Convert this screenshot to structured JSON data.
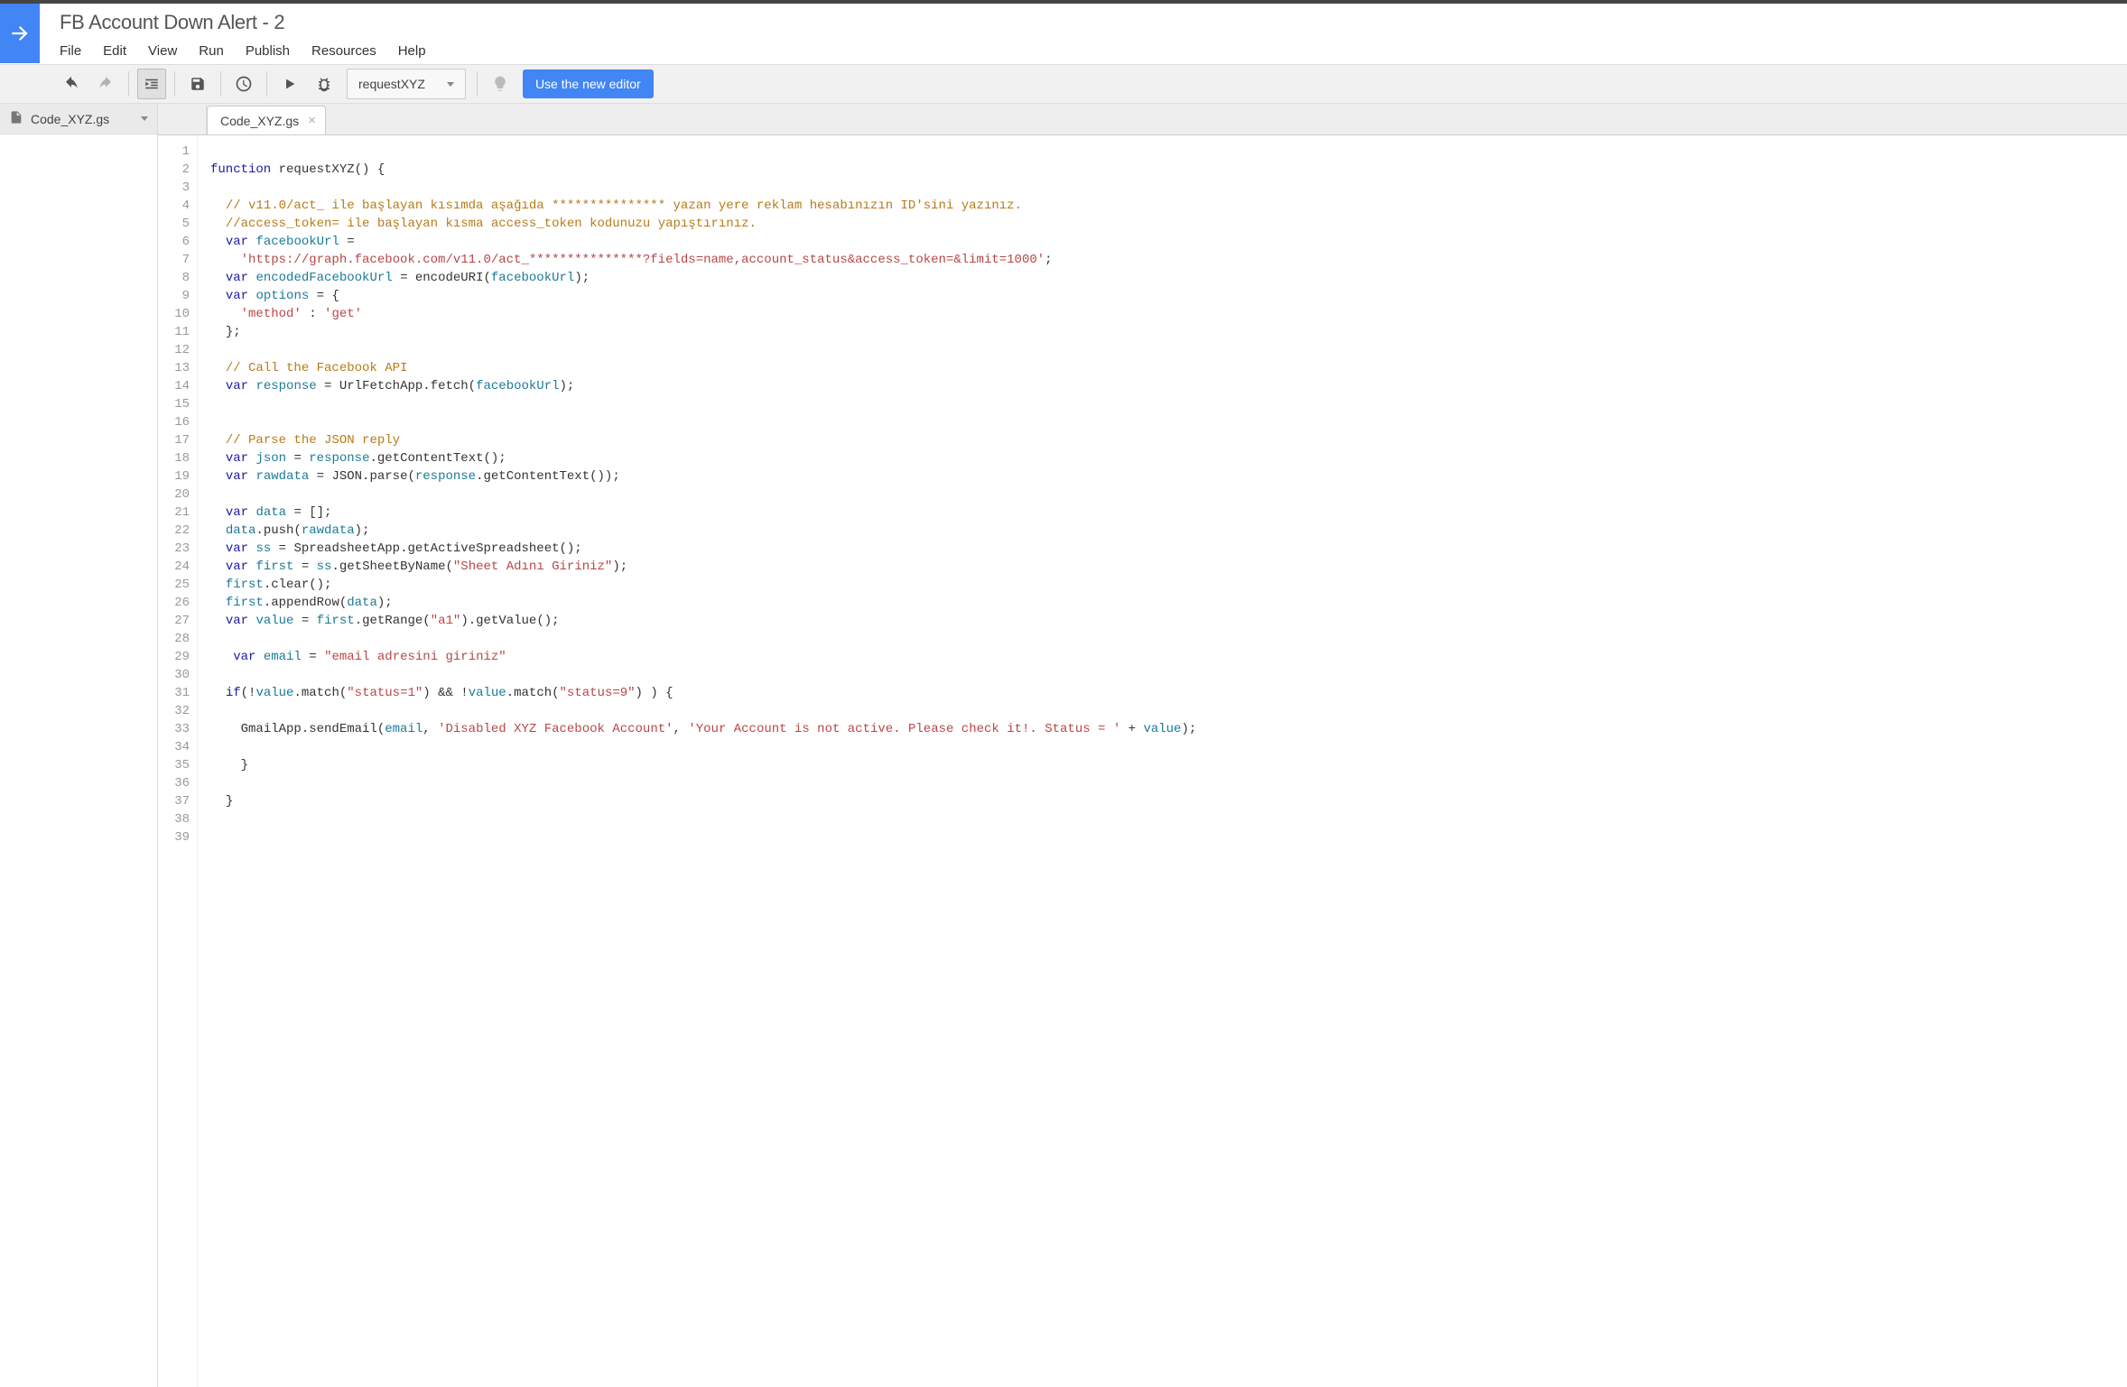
{
  "project": {
    "title": "FB Account Down Alert - 2"
  },
  "menu": {
    "file": "File",
    "edit": "Edit",
    "view": "View",
    "run": "Run",
    "publish": "Publish",
    "resources": "Resources",
    "help": "Help"
  },
  "toolbar": {
    "function_selected": "requestXYZ",
    "new_editor_btn": "Use the new editor"
  },
  "sidebar": {
    "files": [
      {
        "name": "Code_XYZ.gs"
      }
    ]
  },
  "tabs": [
    {
      "label": "Code_XYZ.gs"
    }
  ],
  "editor": {
    "line_count": 39,
    "code_lines": [
      {
        "n": 1,
        "tokens": []
      },
      {
        "n": 2,
        "tokens": [
          {
            "t": "kw",
            "v": "function"
          },
          {
            "t": "pl",
            "v": " requestXYZ() {"
          }
        ]
      },
      {
        "n": 3,
        "tokens": []
      },
      {
        "n": 4,
        "tokens": [
          {
            "t": "sp",
            "v": "  "
          },
          {
            "t": "cm",
            "v": "// v11.0/act_ ile başlayan kısımda aşağıda *************** yazan yere reklam hesabınızın ID'sini yazınız."
          }
        ]
      },
      {
        "n": 5,
        "tokens": [
          {
            "t": "sp",
            "v": "  "
          },
          {
            "t": "cm",
            "v": "//access_token= ile başlayan kısma access_token kodunuzu yapıştırınız."
          }
        ]
      },
      {
        "n": 6,
        "tokens": [
          {
            "t": "sp",
            "v": "  "
          },
          {
            "t": "kw",
            "v": "var"
          },
          {
            "t": "pl",
            "v": " "
          },
          {
            "t": "var",
            "v": "facebookUrl"
          },
          {
            "t": "pl",
            "v": " ="
          }
        ]
      },
      {
        "n": 7,
        "tokens": [
          {
            "t": "sp",
            "v": "    "
          },
          {
            "t": "str",
            "v": "'https://graph.facebook.com/v11.0/act_***************?fields=name,account_status&access_token=&limit=1000'"
          },
          {
            "t": "pl",
            "v": ";"
          }
        ]
      },
      {
        "n": 8,
        "tokens": [
          {
            "t": "sp",
            "v": "  "
          },
          {
            "t": "kw",
            "v": "var"
          },
          {
            "t": "pl",
            "v": " "
          },
          {
            "t": "var",
            "v": "encodedFacebookUrl"
          },
          {
            "t": "pl",
            "v": " = encodeURI("
          },
          {
            "t": "var",
            "v": "facebookUrl"
          },
          {
            "t": "pl",
            "v": ");"
          }
        ]
      },
      {
        "n": 9,
        "tokens": [
          {
            "t": "sp",
            "v": "  "
          },
          {
            "t": "kw",
            "v": "var"
          },
          {
            "t": "pl",
            "v": " "
          },
          {
            "t": "var",
            "v": "options"
          },
          {
            "t": "pl",
            "v": " = {"
          }
        ]
      },
      {
        "n": 10,
        "tokens": [
          {
            "t": "sp",
            "v": "    "
          },
          {
            "t": "str",
            "v": "'method'"
          },
          {
            "t": "pl",
            "v": " : "
          },
          {
            "t": "str",
            "v": "'get'"
          }
        ]
      },
      {
        "n": 11,
        "tokens": [
          {
            "t": "sp",
            "v": "  "
          },
          {
            "t": "pl",
            "v": "};"
          }
        ]
      },
      {
        "n": 12,
        "tokens": []
      },
      {
        "n": 13,
        "tokens": [
          {
            "t": "sp",
            "v": "  "
          },
          {
            "t": "cm",
            "v": "// Call the Facebook API"
          }
        ]
      },
      {
        "n": 14,
        "tokens": [
          {
            "t": "sp",
            "v": "  "
          },
          {
            "t": "kw",
            "v": "var"
          },
          {
            "t": "pl",
            "v": " "
          },
          {
            "t": "var",
            "v": "response"
          },
          {
            "t": "pl",
            "v": " = UrlFetchApp.fetch("
          },
          {
            "t": "var",
            "v": "facebookUrl"
          },
          {
            "t": "pl",
            "v": ");"
          }
        ]
      },
      {
        "n": 15,
        "tokens": []
      },
      {
        "n": 16,
        "tokens": []
      },
      {
        "n": 17,
        "tokens": [
          {
            "t": "sp",
            "v": "  "
          },
          {
            "t": "cm",
            "v": "// Parse the JSON reply"
          }
        ]
      },
      {
        "n": 18,
        "tokens": [
          {
            "t": "sp",
            "v": "  "
          },
          {
            "t": "kw",
            "v": "var"
          },
          {
            "t": "pl",
            "v": " "
          },
          {
            "t": "var",
            "v": "json"
          },
          {
            "t": "pl",
            "v": " = "
          },
          {
            "t": "var",
            "v": "response"
          },
          {
            "t": "pl",
            "v": ".getContentText();"
          }
        ]
      },
      {
        "n": 19,
        "tokens": [
          {
            "t": "sp",
            "v": "  "
          },
          {
            "t": "kw",
            "v": "var"
          },
          {
            "t": "pl",
            "v": " "
          },
          {
            "t": "var",
            "v": "rawdata"
          },
          {
            "t": "pl",
            "v": " = JSON.parse("
          },
          {
            "t": "var",
            "v": "response"
          },
          {
            "t": "pl",
            "v": ".getContentText());"
          }
        ]
      },
      {
        "n": 20,
        "tokens": []
      },
      {
        "n": 21,
        "tokens": [
          {
            "t": "sp",
            "v": "  "
          },
          {
            "t": "kw",
            "v": "var"
          },
          {
            "t": "pl",
            "v": " "
          },
          {
            "t": "var",
            "v": "data"
          },
          {
            "t": "pl",
            "v": " = [];"
          }
        ]
      },
      {
        "n": 22,
        "tokens": [
          {
            "t": "sp",
            "v": "  "
          },
          {
            "t": "var",
            "v": "data"
          },
          {
            "t": "pl",
            "v": ".push("
          },
          {
            "t": "var",
            "v": "rawdata"
          },
          {
            "t": "pl",
            "v": ");"
          }
        ]
      },
      {
        "n": 23,
        "tokens": [
          {
            "t": "sp",
            "v": "  "
          },
          {
            "t": "kw",
            "v": "var"
          },
          {
            "t": "pl",
            "v": " "
          },
          {
            "t": "var",
            "v": "ss"
          },
          {
            "t": "pl",
            "v": " = SpreadsheetApp.getActiveSpreadsheet();"
          }
        ]
      },
      {
        "n": 24,
        "tokens": [
          {
            "t": "sp",
            "v": "  "
          },
          {
            "t": "kw",
            "v": "var"
          },
          {
            "t": "pl",
            "v": " "
          },
          {
            "t": "var",
            "v": "first"
          },
          {
            "t": "pl",
            "v": " = "
          },
          {
            "t": "var",
            "v": "ss"
          },
          {
            "t": "pl",
            "v": ".getSheetByName("
          },
          {
            "t": "str",
            "v": "\"Sheet Adını Giriniz\""
          },
          {
            "t": "pl",
            "v": ");"
          }
        ]
      },
      {
        "n": 25,
        "tokens": [
          {
            "t": "sp",
            "v": "  "
          },
          {
            "t": "var",
            "v": "first"
          },
          {
            "t": "pl",
            "v": ".clear();"
          }
        ]
      },
      {
        "n": 26,
        "tokens": [
          {
            "t": "sp",
            "v": "  "
          },
          {
            "t": "var",
            "v": "first"
          },
          {
            "t": "pl",
            "v": ".appendRow("
          },
          {
            "t": "var",
            "v": "data"
          },
          {
            "t": "pl",
            "v": ");"
          }
        ]
      },
      {
        "n": 27,
        "tokens": [
          {
            "t": "sp",
            "v": "  "
          },
          {
            "t": "kw",
            "v": "var"
          },
          {
            "t": "pl",
            "v": " "
          },
          {
            "t": "var",
            "v": "value"
          },
          {
            "t": "pl",
            "v": " = "
          },
          {
            "t": "var",
            "v": "first"
          },
          {
            "t": "pl",
            "v": ".getRange("
          },
          {
            "t": "str",
            "v": "\"a1\""
          },
          {
            "t": "pl",
            "v": ").getValue();"
          }
        ]
      },
      {
        "n": 28,
        "tokens": []
      },
      {
        "n": 29,
        "tokens": [
          {
            "t": "sp",
            "v": "   "
          },
          {
            "t": "kw",
            "v": "var"
          },
          {
            "t": "pl",
            "v": " "
          },
          {
            "t": "var",
            "v": "email"
          },
          {
            "t": "pl",
            "v": " = "
          },
          {
            "t": "str",
            "v": "\"email adresini giriniz\""
          }
        ]
      },
      {
        "n": 30,
        "tokens": []
      },
      {
        "n": 31,
        "tokens": [
          {
            "t": "sp",
            "v": "  "
          },
          {
            "t": "kw",
            "v": "if"
          },
          {
            "t": "pl",
            "v": "(!"
          },
          {
            "t": "var",
            "v": "value"
          },
          {
            "t": "pl",
            "v": ".match("
          },
          {
            "t": "str",
            "v": "\"status=1\""
          },
          {
            "t": "pl",
            "v": ") && !"
          },
          {
            "t": "var",
            "v": "value"
          },
          {
            "t": "pl",
            "v": ".match("
          },
          {
            "t": "str",
            "v": "\"status=9\""
          },
          {
            "t": "pl",
            "v": ") ) {"
          }
        ]
      },
      {
        "n": 32,
        "tokens": []
      },
      {
        "n": 33,
        "tokens": [
          {
            "t": "sp",
            "v": "    "
          },
          {
            "t": "pl",
            "v": "GmailApp.sendEmail("
          },
          {
            "t": "var",
            "v": "email"
          },
          {
            "t": "pl",
            "v": ", "
          },
          {
            "t": "str",
            "v": "'Disabled XYZ Facebook Account'"
          },
          {
            "t": "pl",
            "v": ", "
          },
          {
            "t": "str",
            "v": "'Your Account is not active. Please check it!. Status = '"
          },
          {
            "t": "pl",
            "v": " + "
          },
          {
            "t": "var",
            "v": "value"
          },
          {
            "t": "pl",
            "v": ");"
          }
        ]
      },
      {
        "n": 34,
        "tokens": []
      },
      {
        "n": 35,
        "tokens": [
          {
            "t": "sp",
            "v": "    "
          },
          {
            "t": "pl",
            "v": "}"
          }
        ]
      },
      {
        "n": 36,
        "tokens": []
      },
      {
        "n": 37,
        "tokens": [
          {
            "t": "sp",
            "v": "  "
          },
          {
            "t": "pl",
            "v": "}"
          }
        ]
      },
      {
        "n": 38,
        "tokens": []
      },
      {
        "n": 39,
        "tokens": []
      }
    ]
  }
}
